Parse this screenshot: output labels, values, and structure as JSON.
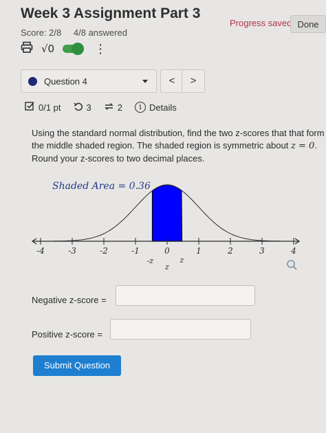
{
  "header": {
    "title": "Week 3 Assignment Part 3",
    "score": "Score: 2/8",
    "answered": "4/8 answered",
    "progress_status": "Progress saved",
    "done_label": "Done"
  },
  "toolbar": {
    "sqrt_label": "√0",
    "more_label": "⋮"
  },
  "question_nav": {
    "selected": "Question 4",
    "prev_label": "<",
    "next_label": ">"
  },
  "question_meta": {
    "points": "0/1 pt",
    "retries": "3",
    "attempts": "2",
    "details_label": "Details"
  },
  "question": {
    "text_part1": "Using the standard normal distribution, find the two z-scores that that form the middle shaded region. The shaded region is symmetric about ",
    "math": "z = 0",
    "text_part2": ". Round your z-scores to two decimal places."
  },
  "graph": {
    "shaded_area_label": "Shaded Area = 0.36",
    "ticks": [
      "-4",
      "-3",
      "-2",
      "-1",
      "0",
      "1",
      "2",
      "3",
      "4"
    ],
    "neg_z": "-z",
    "z_label": "z",
    "z_center": "z",
    "shaded_area": 0.36,
    "x_range": [
      -4,
      4
    ],
    "shade_color": "#0000ff"
  },
  "form": {
    "negative_label": "Negative z-score =",
    "positive_label": "Positive z-score =",
    "negative_value": "",
    "positive_value": "",
    "submit_label": "Submit Question"
  }
}
